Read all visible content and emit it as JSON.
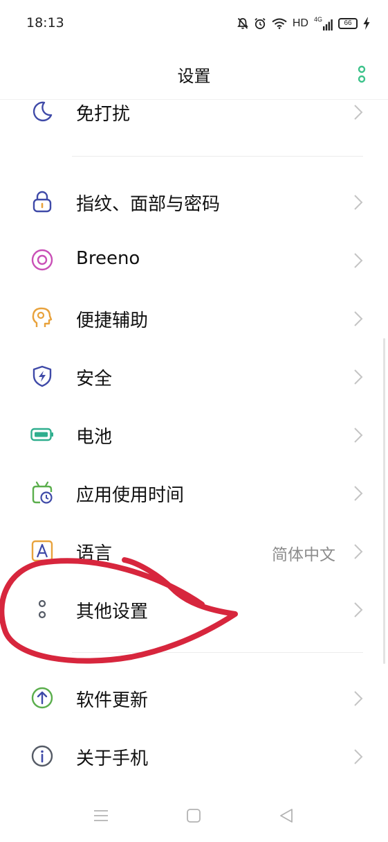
{
  "status_bar": {
    "time": "18:13",
    "network_label": "HD",
    "signal_label": "4G",
    "battery_level": "66",
    "icons": [
      "mute-bell-icon",
      "alarm-icon",
      "wifi-icon",
      "signal-icon",
      "battery-icon",
      "charging-icon"
    ]
  },
  "header": {
    "title": "设置",
    "menu_icon": "more-vertical-icon",
    "accent_color": "#3cc28a"
  },
  "settings": {
    "items": [
      {
        "label": "免打扰",
        "icon": "moon-icon"
      },
      {
        "label": "指纹、面部与密码",
        "icon": "lock-icon"
      },
      {
        "label": "Breeno",
        "icon": "breeno-icon"
      },
      {
        "label": "便捷辅助",
        "icon": "assist-head-icon"
      },
      {
        "label": "安全",
        "icon": "shield-icon"
      },
      {
        "label": "电池",
        "icon": "battery-icon"
      },
      {
        "label": "应用使用时间",
        "icon": "app-time-icon"
      },
      {
        "label": "语言",
        "icon": "language-icon",
        "value": "简体中文"
      },
      {
        "label": "其他设置",
        "icon": "other-settings-icon"
      },
      {
        "label": "软件更新",
        "icon": "update-icon"
      },
      {
        "label": "关于手机",
        "icon": "info-icon"
      }
    ]
  },
  "annotation": {
    "type": "hand-drawn-ellipse",
    "color": "#d7263d",
    "target": "其他设置"
  },
  "bottom_nav": {
    "buttons": [
      "menu-icon",
      "home-icon",
      "back-icon"
    ]
  }
}
